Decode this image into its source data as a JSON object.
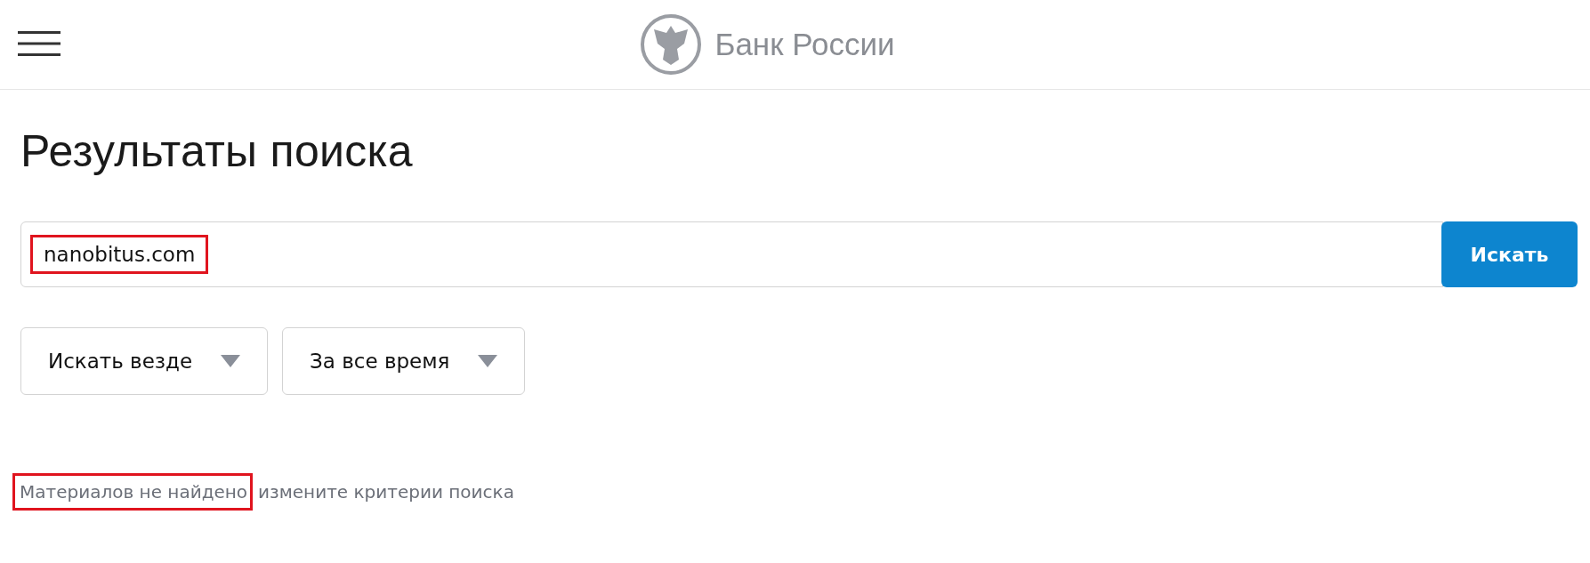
{
  "header": {
    "logo_text": "Банк России"
  },
  "title": "Результаты поиска",
  "search": {
    "value": "nanobitus.com",
    "highlighted": true,
    "button": "Искать"
  },
  "filters": [
    {
      "label": "Искать везде"
    },
    {
      "label": "За все время"
    }
  ],
  "message": {
    "text": "Материалов не найдено",
    "highlighted": true,
    "hint": "измените критерии поиска"
  }
}
